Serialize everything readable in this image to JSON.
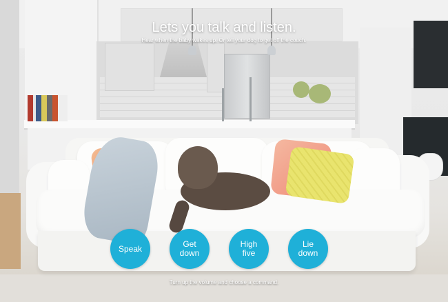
{
  "hero": {
    "title": "Lets you talk and listen.",
    "subtitle": "Hear when the baby wakes up. Or tell your dog to get off the couch."
  },
  "commands": [
    {
      "label": "Speak"
    },
    {
      "label": "Get\ndown"
    },
    {
      "label": "High\nfive"
    },
    {
      "label": "Lie\ndown"
    }
  ],
  "caption": "Turn up the volume and choose a command.",
  "colors": {
    "button": "#1fb0d8",
    "text": "#ffffff"
  }
}
